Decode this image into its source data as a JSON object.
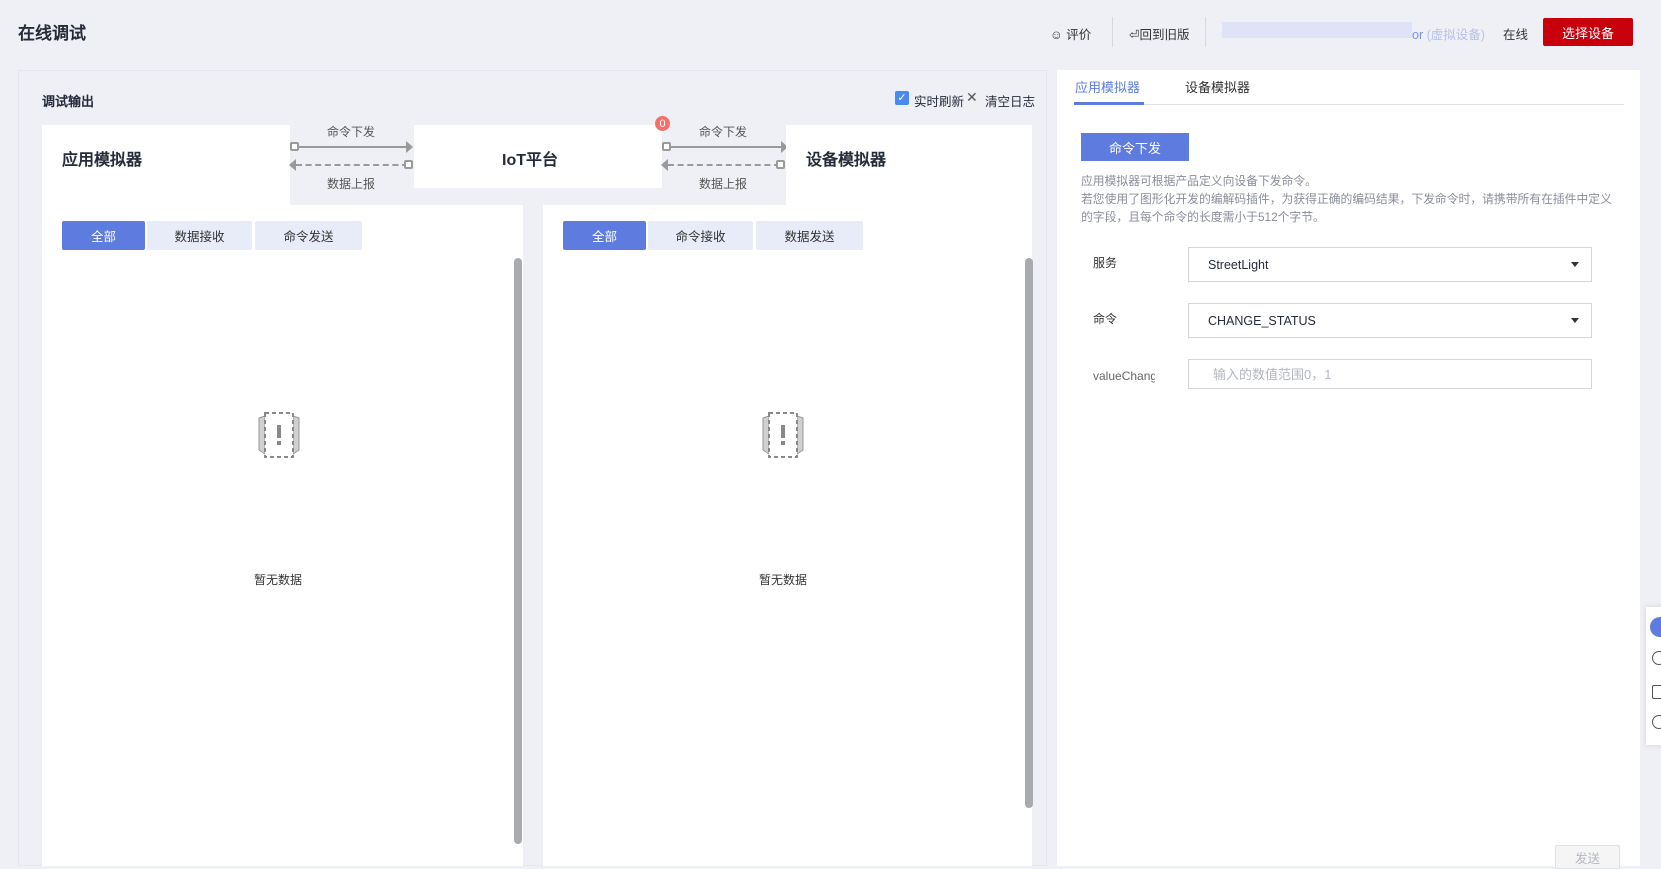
{
  "header": {
    "title": "在线调试",
    "rate_label": "评价",
    "old_version_label": "回到旧版",
    "device_name_suffix": "or",
    "device_type": "(虚拟设备)",
    "status": "在线",
    "select_device_label": "选择设备",
    "accent": "#c7000b"
  },
  "output": {
    "title": "调试输出",
    "realtime_label": "实时刷新",
    "realtime_checked": true,
    "clear_label": "清空日志",
    "app_sim": {
      "title": "应用模拟器",
      "tabs": [
        "全部",
        "数据接收",
        "命令发送"
      ],
      "active_tab": 0,
      "empty": "暂无数据"
    },
    "platform": {
      "title": "IoT平台",
      "badge": "0"
    },
    "device_sim": {
      "title": "设备模拟器",
      "tabs": [
        "全部",
        "命令接收",
        "数据发送"
      ],
      "active_tab": 0,
      "empty": "暂无数据"
    },
    "connector_left": {
      "down": "命令下发",
      "up": "数据上报"
    },
    "connector_right": {
      "down": "命令下发",
      "up": "数据上报"
    }
  },
  "right": {
    "tabs": [
      "应用模拟器",
      "设备模拟器"
    ],
    "active_tab": 0,
    "primary_accent": "#5e7ce0",
    "cmd_button": "命令下发",
    "desc_line1": "应用模拟器可根据产品定义向设备下发命令。",
    "desc_line2": "若您使用了图形化开发的编解码插件，为获得正确的编码结果，下发命令时，请携带所有在插件中定义的字段，且每个命令的长度需小于512个字节。",
    "service_label": "服务",
    "service_value": "StreetLight",
    "command_label": "命令",
    "command_value": "CHANGE_STATUS",
    "param_label": "valueChang",
    "param_placeholder": "输入的数值范围0，1",
    "send_label": "发送"
  }
}
